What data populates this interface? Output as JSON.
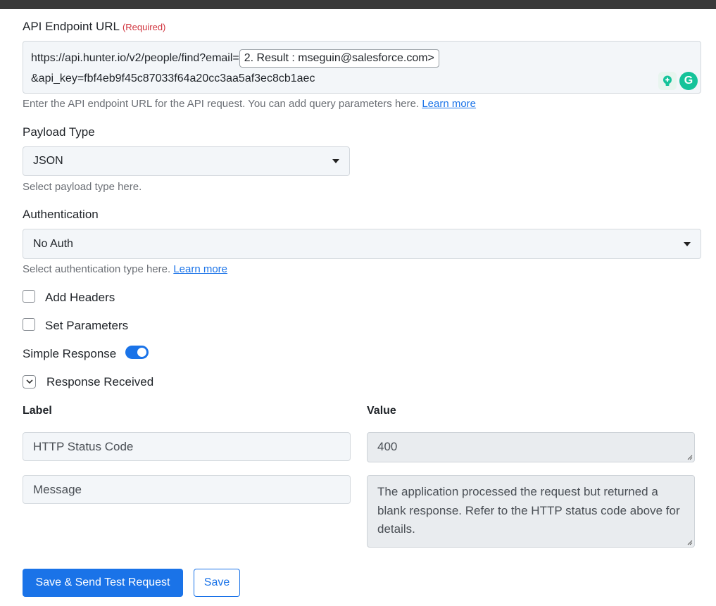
{
  "endpoint": {
    "label": "API Endpoint URL",
    "required": "(Required)",
    "url_prefix": "https://api.hunter.io/v2/people/find?email=",
    "token": "2. Result : mseguin@salesforce.com>",
    "url_suffix": "&api_key=fbf4eb9f45c87033f64a20cc3aa5af3ec8cb1aec",
    "help": "Enter the API endpoint URL for the API request. You can add query parameters here.",
    "learn_more": "Learn more"
  },
  "payload": {
    "label": "Payload Type",
    "value": "JSON",
    "help": "Select payload type here."
  },
  "auth": {
    "label": "Authentication",
    "value": "No Auth",
    "help": "Select authentication type here.",
    "learn_more": "Learn more"
  },
  "options": {
    "add_headers": "Add Headers",
    "set_parameters": "Set Parameters",
    "simple_response": "Simple Response",
    "simple_response_on": true,
    "response_received": "Response Received"
  },
  "response": {
    "label_header": "Label",
    "value_header": "Value",
    "rows": [
      {
        "label": "HTTP Status Code",
        "value": "400"
      },
      {
        "label": "Message",
        "value": "The application processed the request but returned a blank response.  Refer to the HTTP status code above for details."
      }
    ]
  },
  "buttons": {
    "save_send": "Save & Send Test Request",
    "save": "Save"
  },
  "colors": {
    "accent": "#1a73e8",
    "required": "#d0323c",
    "grammarly": "#15c39a"
  }
}
